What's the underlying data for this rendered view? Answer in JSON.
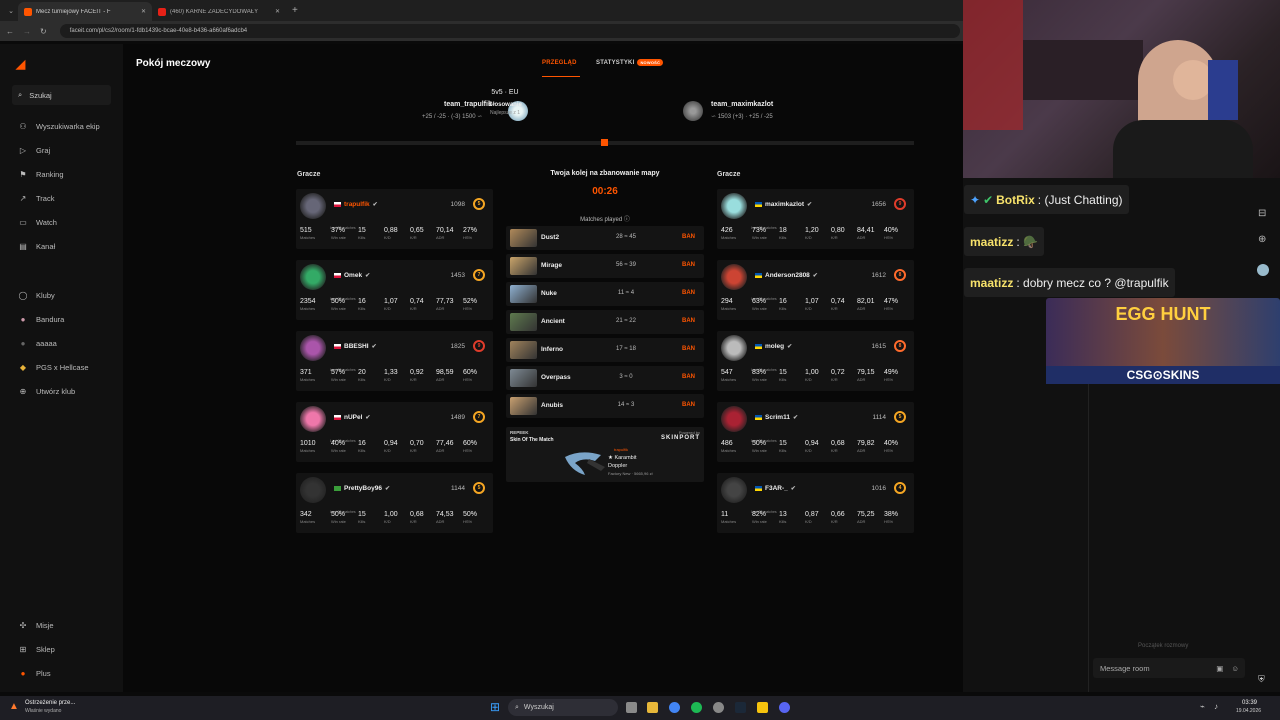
{
  "browser": {
    "tabs": [
      {
        "title": "Mecz turniejowy FACEIT - F",
        "active": true
      },
      {
        "title": "(460) KARNE ZADECYDOWAŁY",
        "active": false
      }
    ],
    "url": "faceit.com/pl/cs2/room/1-fdb1439c-bcae-40e8-b436-a660af6adcb4"
  },
  "sidebar": {
    "search_label": "Szukaj",
    "items": [
      {
        "label": "Wyszukiwarka ekip",
        "icon": "people-search-icon"
      },
      {
        "label": "Graj",
        "icon": "play-icon"
      },
      {
        "label": "Ranking",
        "icon": "ranking-icon"
      },
      {
        "label": "Track",
        "icon": "track-icon"
      },
      {
        "label": "Watch",
        "icon": "watch-icon"
      },
      {
        "label": "Kanał",
        "icon": "channel-icon"
      }
    ],
    "clubs": [
      {
        "label": "Kluby",
        "icon": "clubs-icon"
      },
      {
        "label": "Bandura",
        "icon": "club-avatar-icon"
      },
      {
        "label": "aaaaa",
        "icon": "club-avatar-icon"
      },
      {
        "label": "PGS x Hellcase",
        "icon": "club-avatar-icon"
      },
      {
        "label": "Utwórz klub",
        "icon": "plus-circle-icon"
      }
    ],
    "bottom": [
      {
        "label": "Misje",
        "icon": "missions-icon"
      },
      {
        "label": "Sklep",
        "icon": "shop-icon"
      },
      {
        "label": "Plus",
        "icon": "plus-badge-icon"
      }
    ]
  },
  "room": {
    "title": "Pokój meczowy",
    "tabs": {
      "overview": "PRZEGLĄD",
      "stats": "STATYSTYKI",
      "stats_badge": "NOWOŚĆ"
    },
    "mode": "5v5 · EU",
    "phase": "Głosowanie",
    "format": "Najlepsze z 1",
    "team1": {
      "name": "team_trapulfik",
      "sub": "+25 / -25 · (-3) 1500 ∽"
    },
    "team2": {
      "name": "team_maximkazlot",
      "sub": "∽ 1503 (+3) · +25 / -25"
    },
    "players_label": "Gracze",
    "veto_title": "Twoja kolej na zbanowanie mapy",
    "timer": "00:26",
    "matches_played_label": "Matches played ⓘ",
    "last_matches_label": "Last 30 matches",
    "stat_labels": [
      "Matches",
      "Win rate",
      "Kills",
      "K/D",
      "K/R",
      "ADR",
      "HS%"
    ]
  },
  "team1_players": [
    {
      "name": "trapulfik",
      "elo": "1098",
      "level": "5",
      "stats": [
        "515",
        "37%",
        "15",
        "0,88",
        "0,65",
        "70,14",
        "27%"
      ],
      "highlight": true
    },
    {
      "name": "Omek",
      "elo": "1453",
      "level": "7",
      "stats": [
        "2354",
        "50%",
        "16",
        "1,07",
        "0,74",
        "77,73",
        "52%"
      ]
    },
    {
      "name": "BBESHI",
      "elo": "1825",
      "level": "9",
      "stats": [
        "371",
        "57%",
        "20",
        "1,33",
        "0,92",
        "98,59",
        "60%"
      ]
    },
    {
      "name": "nUPel",
      "elo": "1489",
      "level": "7",
      "stats": [
        "1010",
        "40%",
        "16",
        "0,94",
        "0,70",
        "77,46",
        "60%"
      ]
    },
    {
      "name": "PrettyBoy96",
      "elo": "1144",
      "level": "5",
      "stats": [
        "342",
        "50%",
        "15",
        "1,00",
        "0,68",
        "74,53",
        "50%"
      ]
    }
  ],
  "team2_players": [
    {
      "name": "maximkazlot",
      "elo": "1656",
      "level": "9",
      "stats": [
        "426",
        "73%",
        "18",
        "1,20",
        "0,80",
        "84,41",
        "40%"
      ]
    },
    {
      "name": "Anderson2808",
      "elo": "1612",
      "level": "8",
      "stats": [
        "294",
        "63%",
        "16",
        "1,07",
        "0,74",
        "82,01",
        "47%"
      ]
    },
    {
      "name": "moleg",
      "elo": "1615",
      "level": "8",
      "stats": [
        "547",
        "83%",
        "15",
        "1,00",
        "0,72",
        "79,15",
        "49%"
      ]
    },
    {
      "name": "Scrim11",
      "elo": "1114",
      "level": "5",
      "stats": [
        "486",
        "50%",
        "15",
        "0,94",
        "0,68",
        "79,82",
        "40%"
      ]
    },
    {
      "name": "F3AR-_",
      "elo": "1016",
      "level": "4",
      "stats": [
        "11",
        "82%",
        "13",
        "0,87",
        "0,66",
        "75,25",
        "38%"
      ]
    }
  ],
  "maps": [
    {
      "name": "Dust2",
      "score": "28 ≈ 45",
      "action": "BAN",
      "color": "#b08a5a"
    },
    {
      "name": "Mirage",
      "score": "56 ≈ 39",
      "action": "BAN",
      "color": "#c9a46a"
    },
    {
      "name": "Nuke",
      "score": "11 ≈ 4",
      "action": "BAN",
      "color": "#8fb0d0"
    },
    {
      "name": "Ancient",
      "score": "21 ≈ 22",
      "action": "BAN",
      "color": "#5e7a4e"
    },
    {
      "name": "Inferno",
      "score": "17 ≈ 18",
      "action": "BAN",
      "color": "#a0835c"
    },
    {
      "name": "Overpass",
      "score": "3 ≈ 0",
      "action": "BAN",
      "color": "#7e8a94"
    },
    {
      "name": "Anubis",
      "score": "14 ≈ 3",
      "action": "BAN",
      "color": "#c8a070"
    }
  ],
  "promo": {
    "brand": "REPEEK",
    "title": "Skin Of The Match",
    "powered": "Powered by",
    "partner": "SKINPORT",
    "owner": "trapulfik",
    "item": "★ Karambit",
    "skin": "Doppler",
    "condition": "Factory New · 5665,96 zł"
  },
  "stream": {
    "chat": [
      {
        "user": "BotRix",
        "text": "(Just Chatting)"
      },
      {
        "user": "maatizz",
        "text": "🪖"
      },
      {
        "user": "maatizz",
        "text": "dobry mecz co ? @trapulfik"
      }
    ],
    "ad_title": "EGG HUNT",
    "ad_brand": "CSG⊙SKINS",
    "chat_start": "Początek rozmowy",
    "chat_placeholder": "Message room"
  },
  "taskbar": {
    "notification_title": "Ostrzeżenie prze...",
    "notification_sub": "Właśnie wydano",
    "search_label": "Wyszukaj",
    "time": "03:39",
    "date": "19.04.2026"
  },
  "colors": {
    "accent": "#ff5500",
    "level_gold": "#f5a623",
    "level_red": "#e03c2b"
  }
}
